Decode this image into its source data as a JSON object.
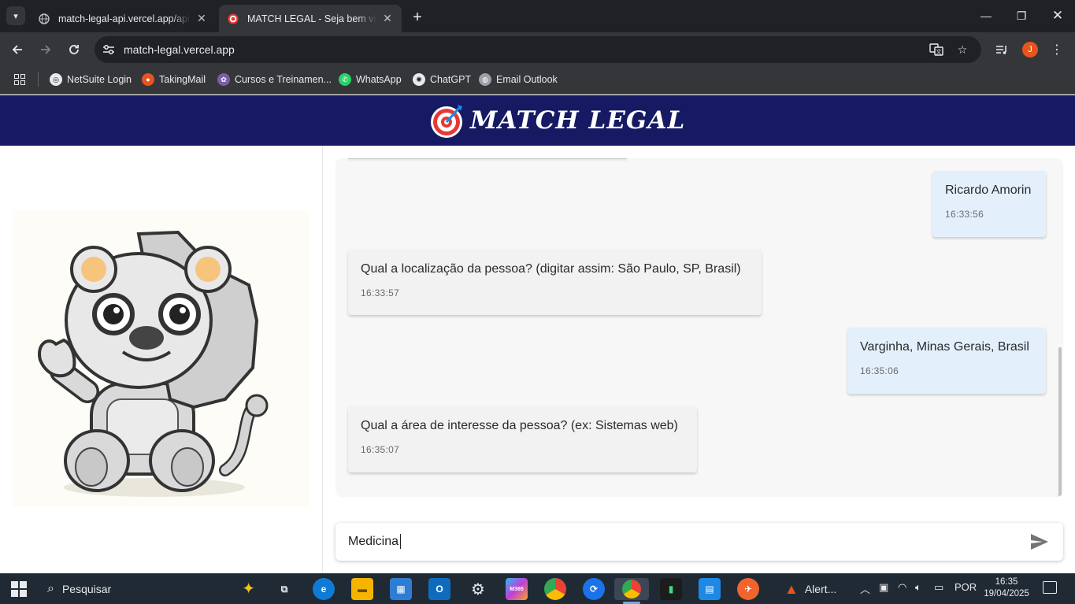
{
  "browser": {
    "tabs": [
      {
        "title": "match-legal-api.vercel.app/api/",
        "active": false
      },
      {
        "title": "MATCH LEGAL - Seja bem vindo",
        "active": true
      }
    ],
    "new_tab_label": "+",
    "address": "match-legal.vercel.app",
    "profile_initial": "J",
    "bookmarks": [
      {
        "label": "NetSuite Login",
        "icon": "netsuite-icon",
        "color": "#3a3a3a"
      },
      {
        "label": "TakingMail",
        "icon": "takingmail-icon",
        "color": "#e8541e"
      },
      {
        "label": "Cursos e Treinamen...",
        "icon": "cursos-icon",
        "color": "#7b5ea7"
      },
      {
        "label": "WhatsApp",
        "icon": "whatsapp-icon",
        "color": "#25d366"
      },
      {
        "label": "ChatGPT",
        "icon": "chatgpt-icon",
        "color": "#3a3a3a"
      },
      {
        "label": "Email Outlook",
        "icon": "globe-icon",
        "color": "#5f6368"
      }
    ]
  },
  "site": {
    "brand": "MATCH LEGAL",
    "brand_colors": {
      "header": "#161a63",
      "target_red": "#e53935"
    }
  },
  "chat": {
    "messages": [
      {
        "from": "user",
        "text": "Ricardo Amorin",
        "time": "16:33:56"
      },
      {
        "from": "bot",
        "text": "Qual a localização da pessoa? (digitar assim: São Paulo, SP, Brasil)",
        "time": "16:33:57"
      },
      {
        "from": "user",
        "text": "Varginha, Minas Gerais, Brasil",
        "time": "16:35:06"
      },
      {
        "from": "bot",
        "text": "Qual a área de interesse da pessoa? (ex: Sistemas web)",
        "time": "16:35:07"
      }
    ],
    "input_value": "Medicina",
    "colors": {
      "user_bubble": "#e3f0fc",
      "bot_bubble": "#f2f2f2"
    }
  },
  "taskbar": {
    "search_label": "Pesquisar",
    "alert_label": "Alert...",
    "language": "POR",
    "time": "16:35",
    "date": "19/04/2025",
    "m365_label": "M365"
  }
}
